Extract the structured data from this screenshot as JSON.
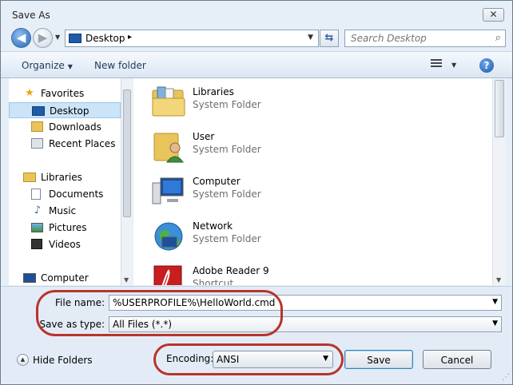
{
  "window": {
    "title": "Save As"
  },
  "titlebar": {
    "close_glyph": "✕"
  },
  "navigation": {
    "address": {
      "location": "Desktop",
      "separator": "▸"
    },
    "search_placeholder": "Search Desktop"
  },
  "toolbar": {
    "organize_label": "Organize",
    "new_folder_label": "New folder",
    "help_glyph": "?"
  },
  "sidebar": {
    "items": [
      {
        "label": "Favorites",
        "icon": "star-icon",
        "group": true
      },
      {
        "label": "Desktop",
        "icon": "desktop-icon",
        "selected": true
      },
      {
        "label": "Downloads",
        "icon": "downloads-icon"
      },
      {
        "label": "Recent Places",
        "icon": "recent-places-icon"
      },
      {
        "label": "Libraries",
        "icon": "libraries-icon",
        "group": true
      },
      {
        "label": "Documents",
        "icon": "documents-icon"
      },
      {
        "label": "Music",
        "icon": "music-icon"
      },
      {
        "label": "Pictures",
        "icon": "pictures-icon"
      },
      {
        "label": "Videos",
        "icon": "videos-icon"
      },
      {
        "label": "Computer",
        "icon": "computer-icon",
        "group": true
      }
    ]
  },
  "content": {
    "items": [
      {
        "name": "Libraries",
        "type": "System Folder",
        "icon": "libraries-folder-icon"
      },
      {
        "name": "User",
        "type": "System Folder",
        "icon": "user-folder-icon"
      },
      {
        "name": "Computer",
        "type": "System Folder",
        "icon": "computer-icon"
      },
      {
        "name": "Network",
        "type": "System Folder",
        "icon": "network-globe-icon"
      },
      {
        "name": "Adobe Reader 9",
        "type": "Shortcut",
        "icon": "adobe-reader-icon"
      }
    ]
  },
  "form": {
    "file_name_label": "File name:",
    "file_name_value": "%USERPROFILE%\\HelloWorld.cmd",
    "save_type_label": "Save as type:",
    "save_type_value": "All Files  (*.*)"
  },
  "footer": {
    "hide_folders_label": "Hide Folders",
    "encoding_label": "Encoding:",
    "encoding_value": "ANSI",
    "save_label": "Save",
    "cancel_label": "Cancel"
  },
  "colors": {
    "highlight_ring": "#b8342c",
    "selection": "#cce4f7",
    "window_chrome": "#e6eef7"
  }
}
